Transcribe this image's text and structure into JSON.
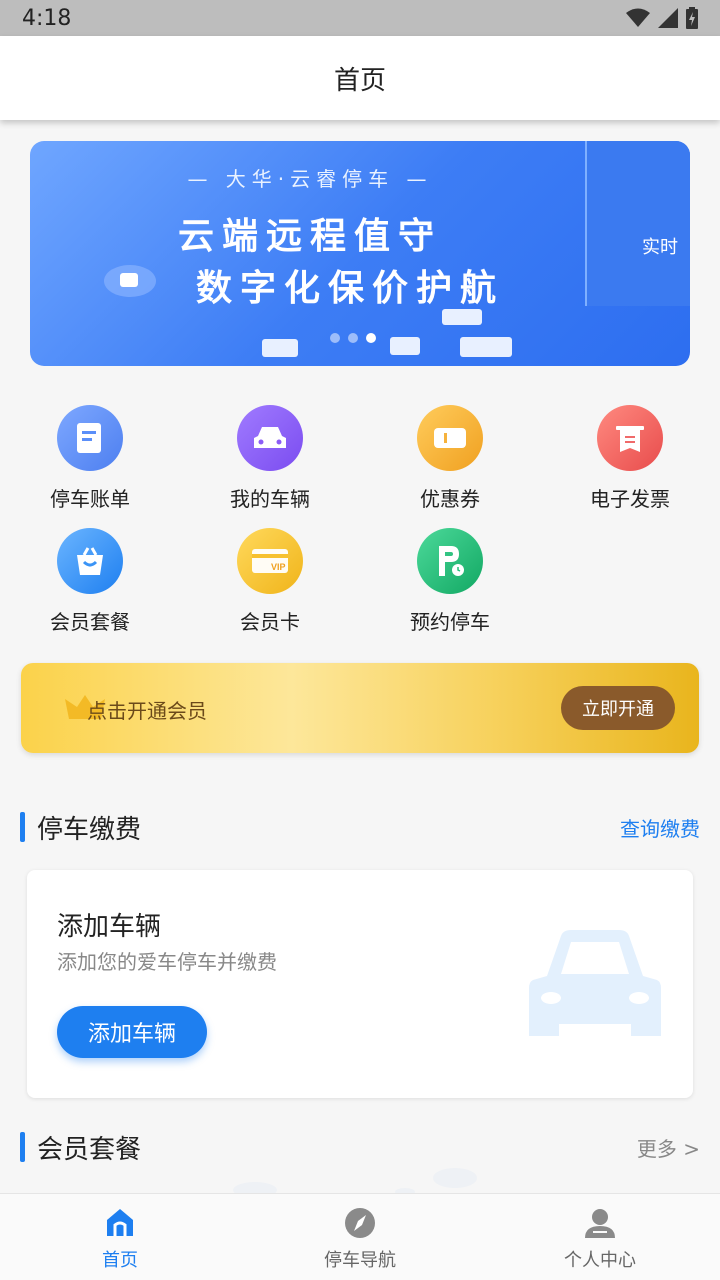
{
  "status": {
    "time": "4:18"
  },
  "header": {
    "title": "首页"
  },
  "banner": {
    "subtitle": "— 大华·云睿停车 —",
    "line1": "云端远程值守",
    "line2": "数字化保价护航",
    "side_text": "实时"
  },
  "grid": {
    "items": [
      {
        "label": "停车账单",
        "icon": "bill-icon",
        "color": "#5b8ff9"
      },
      {
        "label": "我的车辆",
        "icon": "car-icon",
        "color": "#8b5cf6"
      },
      {
        "label": "优惠券",
        "icon": "coupon-icon",
        "color": "#f6b23c"
      },
      {
        "label": "电子发票",
        "icon": "invoice-icon",
        "color": "#f06a6a"
      },
      {
        "label": "会员套餐",
        "icon": "bag-icon",
        "color": "#3b94f6"
      },
      {
        "label": "会员卡",
        "icon": "vip-card-icon",
        "color": "#f7c12f"
      },
      {
        "label": "预约停车",
        "icon": "reserve-parking-icon",
        "color": "#22c27a"
      }
    ]
  },
  "vip_banner": {
    "text": "点击开通会员",
    "button": "立即开通"
  },
  "parking": {
    "title": "停车缴费",
    "link": "查询缴费"
  },
  "add_card": {
    "title": "添加车辆",
    "subtitle": "添加您的爱车停车并缴费",
    "button": "添加车辆"
  },
  "membership": {
    "title": "会员套餐",
    "link": "更多 >"
  },
  "tabbar": {
    "items": [
      {
        "label": "首页",
        "icon": "home-icon"
      },
      {
        "label": "停车导航",
        "icon": "compass-icon"
      },
      {
        "label": "个人中心",
        "icon": "user-icon"
      }
    ]
  }
}
